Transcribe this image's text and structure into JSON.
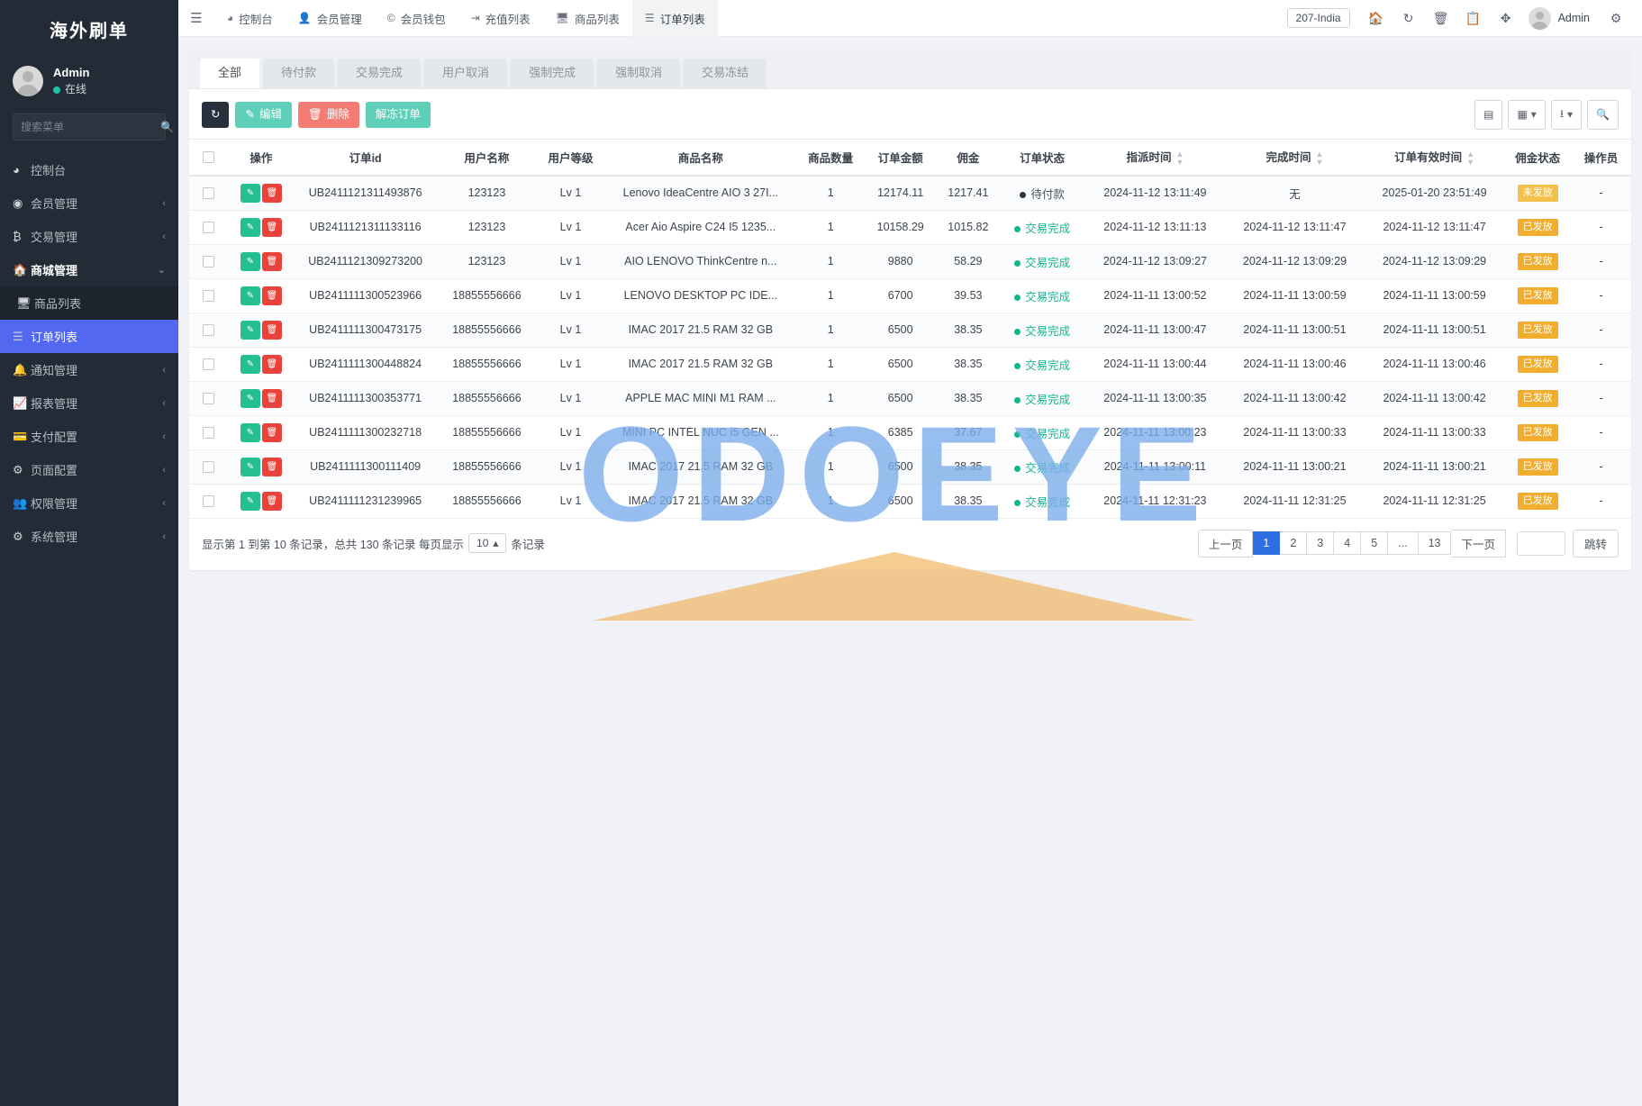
{
  "sidebar": {
    "brand": "海外刷单",
    "profile": {
      "name": "Admin",
      "status": "在线"
    },
    "search_placeholder": "搜索菜单",
    "items": [
      {
        "label": "控制台",
        "icon": "dashboard-icon",
        "arrow": ""
      },
      {
        "label": "会员管理",
        "icon": "user-circle-icon",
        "arrow": "‹"
      },
      {
        "label": "交易管理",
        "icon": "bitcoin-icon",
        "arrow": "‹"
      },
      {
        "label": "商城管理",
        "icon": "home-icon",
        "arrow": "⌄"
      },
      {
        "label": "商品列表",
        "icon": "monitor-icon",
        "arrow": ""
      },
      {
        "label": "订单列表",
        "icon": "list-icon",
        "arrow": ""
      },
      {
        "label": "通知管理",
        "icon": "bell-icon",
        "arrow": "‹"
      },
      {
        "label": "报表管理",
        "icon": "chart-icon",
        "arrow": "‹"
      },
      {
        "label": "支付配置",
        "icon": "card-icon",
        "arrow": "‹"
      },
      {
        "label": "页面配置",
        "icon": "gear-icon",
        "arrow": "‹"
      },
      {
        "label": "权限管理",
        "icon": "users-icon",
        "arrow": "‹"
      },
      {
        "label": "系统管理",
        "icon": "cogs-icon",
        "arrow": "‹"
      }
    ]
  },
  "topbar": {
    "menu_icon": "hamburger-icon",
    "nav": [
      {
        "label": "控制台",
        "icon": "dashboard-icon"
      },
      {
        "label": "会员管理",
        "icon": "user-icon"
      },
      {
        "label": "会员钱包",
        "icon": "coin-icon"
      },
      {
        "label": "充值列表",
        "icon": "arrow-in-icon"
      },
      {
        "label": "商品列表",
        "icon": "monitor-icon"
      },
      {
        "label": "订单列表",
        "icon": "list-icon"
      }
    ],
    "region": "207-India",
    "icons": [
      "home-icon",
      "refresh-icon",
      "trash-icon",
      "copy-icon",
      "fullscreen-icon"
    ],
    "username": "Admin",
    "settings_icon": "gears-icon"
  },
  "tabs": [
    {
      "label": "全部"
    },
    {
      "label": "待付款"
    },
    {
      "label": "交易完成"
    },
    {
      "label": "用户取消"
    },
    {
      "label": "强制完成"
    },
    {
      "label": "强制取消"
    },
    {
      "label": "交易冻结"
    }
  ],
  "toolbar": {
    "refresh_icon": "refresh-icon",
    "edit_label": "编辑",
    "edit_icon": "pencil-icon",
    "delete_label": "删除",
    "delete_icon": "trash-icon",
    "unfreeze_label": "解冻订单",
    "right_icons": [
      "rows-icon",
      "columns-icon",
      "export-icon",
      "search-icon"
    ]
  },
  "table": {
    "columns": [
      "操作",
      "订单id",
      "用户名称",
      "用户等级",
      "商品名称",
      "商品数量",
      "订单金额",
      "佣金",
      "订单状态",
      "指派时间",
      "完成时间",
      "订单有效时间",
      "佣金状态",
      "操作员"
    ],
    "sortable": [
      "指派时间",
      "完成时间",
      "订单有效时间"
    ],
    "rows": [
      {
        "order_id": "UB2411121311493876",
        "user": "123123",
        "level": "Lv 1",
        "product": "Lenovo IdeaCentre AIO 3 27I...",
        "qty": "1",
        "amount": "12174.11",
        "commission": "1217.41",
        "status": "待付款",
        "status_type": "pending",
        "assign_time": "2024-11-12 13:11:49",
        "finish_time": "无",
        "valid_time": "2025-01-20 23:51:49",
        "commission_status": "未发放",
        "commission_badge": "unsent",
        "operator": "-"
      },
      {
        "order_id": "UB2411121311133116",
        "user": "123123",
        "level": "Lv 1",
        "product": "Acer Aio Aspire C24 I5 1235...",
        "qty": "1",
        "amount": "10158.29",
        "commission": "1015.82",
        "status": "交易完成",
        "status_type": "done",
        "assign_time": "2024-11-12 13:11:13",
        "finish_time": "2024-11-12 13:11:47",
        "valid_time": "2024-11-12 13:11:47",
        "commission_status": "已发放",
        "commission_badge": "sent",
        "operator": "-"
      },
      {
        "order_id": "UB2411121309273200",
        "user": "123123",
        "level": "Lv 1",
        "product": "AIO LENOVO ThinkCentre n...",
        "qty": "1",
        "amount": "9880",
        "commission": "58.29",
        "status": "交易完成",
        "status_type": "done",
        "assign_time": "2024-11-12 13:09:27",
        "finish_time": "2024-11-12 13:09:29",
        "valid_time": "2024-11-12 13:09:29",
        "commission_status": "已发放",
        "commission_badge": "sent",
        "operator": "-"
      },
      {
        "order_id": "UB2411111300523966",
        "user": "18855556666",
        "level": "Lv 1",
        "product": "LENOVO DESKTOP PC IDE...",
        "qty": "1",
        "amount": "6700",
        "commission": "39.53",
        "status": "交易完成",
        "status_type": "done",
        "assign_time": "2024-11-11 13:00:52",
        "finish_time": "2024-11-11 13:00:59",
        "valid_time": "2024-11-11 13:00:59",
        "commission_status": "已发放",
        "commission_badge": "sent",
        "operator": "-"
      },
      {
        "order_id": "UB2411111300473175",
        "user": "18855556666",
        "level": "Lv 1",
        "product": "IMAC 2017 21.5 RAM 32 GB",
        "qty": "1",
        "amount": "6500",
        "commission": "38.35",
        "status": "交易完成",
        "status_type": "done",
        "assign_time": "2024-11-11 13:00:47",
        "finish_time": "2024-11-11 13:00:51",
        "valid_time": "2024-11-11 13:00:51",
        "commission_status": "已发放",
        "commission_badge": "sent",
        "operator": "-"
      },
      {
        "order_id": "UB2411111300448824",
        "user": "18855556666",
        "level": "Lv 1",
        "product": "IMAC 2017 21.5 RAM 32 GB",
        "qty": "1",
        "amount": "6500",
        "commission": "38.35",
        "status": "交易完成",
        "status_type": "done",
        "assign_time": "2024-11-11 13:00:44",
        "finish_time": "2024-11-11 13:00:46",
        "valid_time": "2024-11-11 13:00:46",
        "commission_status": "已发放",
        "commission_badge": "sent",
        "operator": "-"
      },
      {
        "order_id": "UB2411111300353771",
        "user": "18855556666",
        "level": "Lv 1",
        "product": "APPLE MAC MINI M1 RAM ...",
        "qty": "1",
        "amount": "6500",
        "commission": "38.35",
        "status": "交易完成",
        "status_type": "done",
        "assign_time": "2024-11-11 13:00:35",
        "finish_time": "2024-11-11 13:00:42",
        "valid_time": "2024-11-11 13:00:42",
        "commission_status": "已发放",
        "commission_badge": "sent",
        "operator": "-"
      },
      {
        "order_id": "UB2411111300232718",
        "user": "18855556666",
        "level": "Lv 1",
        "product": "MINI PC INTEL NUC i5 GEN ...",
        "qty": "1",
        "amount": "6385",
        "commission": "37.67",
        "status": "交易完成",
        "status_type": "done",
        "assign_time": "2024-11-11 13:00:23",
        "finish_time": "2024-11-11 13:00:33",
        "valid_time": "2024-11-11 13:00:33",
        "commission_status": "已发放",
        "commission_badge": "sent",
        "operator": "-"
      },
      {
        "order_id": "UB2411111300111409",
        "user": "18855556666",
        "level": "Lv 1",
        "product": "IMAC 2017 21.5 RAM 32 GB",
        "qty": "1",
        "amount": "6500",
        "commission": "38.35",
        "status": "交易完成",
        "status_type": "done",
        "assign_time": "2024-11-11 13:00:11",
        "finish_time": "2024-11-11 13:00:21",
        "valid_time": "2024-11-11 13:00:21",
        "commission_status": "已发放",
        "commission_badge": "sent",
        "operator": "-"
      },
      {
        "order_id": "UB2411111231239965",
        "user": "18855556666",
        "level": "Lv 1",
        "product": "IMAC 2017 21.5 RAM 32 GB",
        "qty": "1",
        "amount": "6500",
        "commission": "38.35",
        "status": "交易完成",
        "status_type": "done",
        "assign_time": "2024-11-11 12:31:23",
        "finish_time": "2024-11-11 12:31:25",
        "valid_time": "2024-11-11 12:31:25",
        "commission_status": "已发放",
        "commission_badge": "sent",
        "operator": "-"
      }
    ]
  },
  "footer": {
    "summary_pre": "显示第 1 到第 10 条记录，总共 130 条记录 每页显示",
    "page_size": "10",
    "summary_post": "条记录",
    "prev_label": "上一页",
    "pages": [
      "1",
      "2",
      "3",
      "4",
      "5",
      "...",
      "13"
    ],
    "active_page": "1",
    "next_label": "下一页",
    "jump_label": "跳转",
    "jump_value": ""
  },
  "watermark": {
    "text": "ODOEYE"
  }
}
